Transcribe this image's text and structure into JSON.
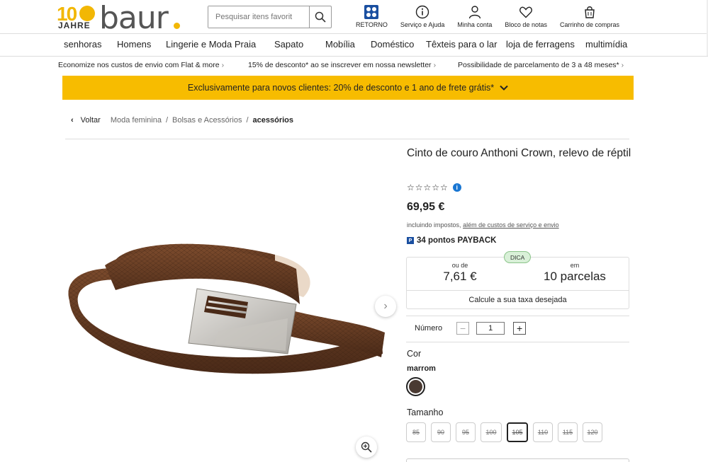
{
  "logo": {
    "hundred": "10",
    "jahre": "JAHRE",
    "brand": "baur"
  },
  "search": {
    "placeholder": "Pesquisar itens favorit"
  },
  "header_icons": [
    {
      "label": "RETORNO",
      "icon": "retorno-icon"
    },
    {
      "label": "Serviço e Ajuda",
      "icon": "info-icon"
    },
    {
      "label": "Minha conta",
      "icon": "user-icon"
    },
    {
      "label": "Bloco de notas",
      "icon": "heart-icon"
    },
    {
      "label": "Carrinho de compras",
      "icon": "cart-icon"
    }
  ],
  "nav": [
    "senhoras",
    "Homens",
    "Lingerie e Moda Praia",
    "Sapato",
    "Mobília",
    "Doméstico",
    "Têxteis para o lar",
    "loja de ferragens",
    "multimídia"
  ],
  "benefits": [
    "Economize nos custos de envio com Flat & more",
    "15% de desconto* ao se inscrever em nossa newsletter",
    "Possibilidade de parcelamento de 3 a 48 meses*"
  ],
  "banner": {
    "text": "Exclusivamente para novos clientes: 20% de desconto e 1 ano de frete grátis*"
  },
  "breadcrumb": {
    "back": "Voltar",
    "items": [
      "Moda feminina",
      "Bolsas e Acessórios"
    ],
    "current": "acessórios"
  },
  "product": {
    "title": "Cinto de couro Anthoni Crown, relevo de réptil",
    "stars_text": "☆☆☆☆☆",
    "rating": 0,
    "price": "69,95 €",
    "tax_prefix": "incluindo impostos,",
    "tax_link": "além de custos de serviço e envio",
    "payback": "34 pontos PAYBACK",
    "install": {
      "badge": "DICA",
      "left_label": "ou de",
      "left_value": "7,61 €",
      "right_label": "em",
      "right_value": "10 parcelas",
      "calc": "Calcule a sua taxa desejada"
    },
    "quantity": {
      "label": "Número",
      "value": "1",
      "minus": "−",
      "plus": "+"
    },
    "color": {
      "label": "Cor",
      "value": "marrom",
      "swatch": "#4a3a32"
    },
    "size": {
      "label": "Tamanho",
      "options": [
        "85",
        "90",
        "95",
        "100",
        "105",
        "110",
        "115",
        "120"
      ],
      "selected": "105"
    }
  },
  "colors": {
    "accent": "#f7bc00",
    "brand_blue": "#1a4fa0",
    "text": "#222222"
  }
}
